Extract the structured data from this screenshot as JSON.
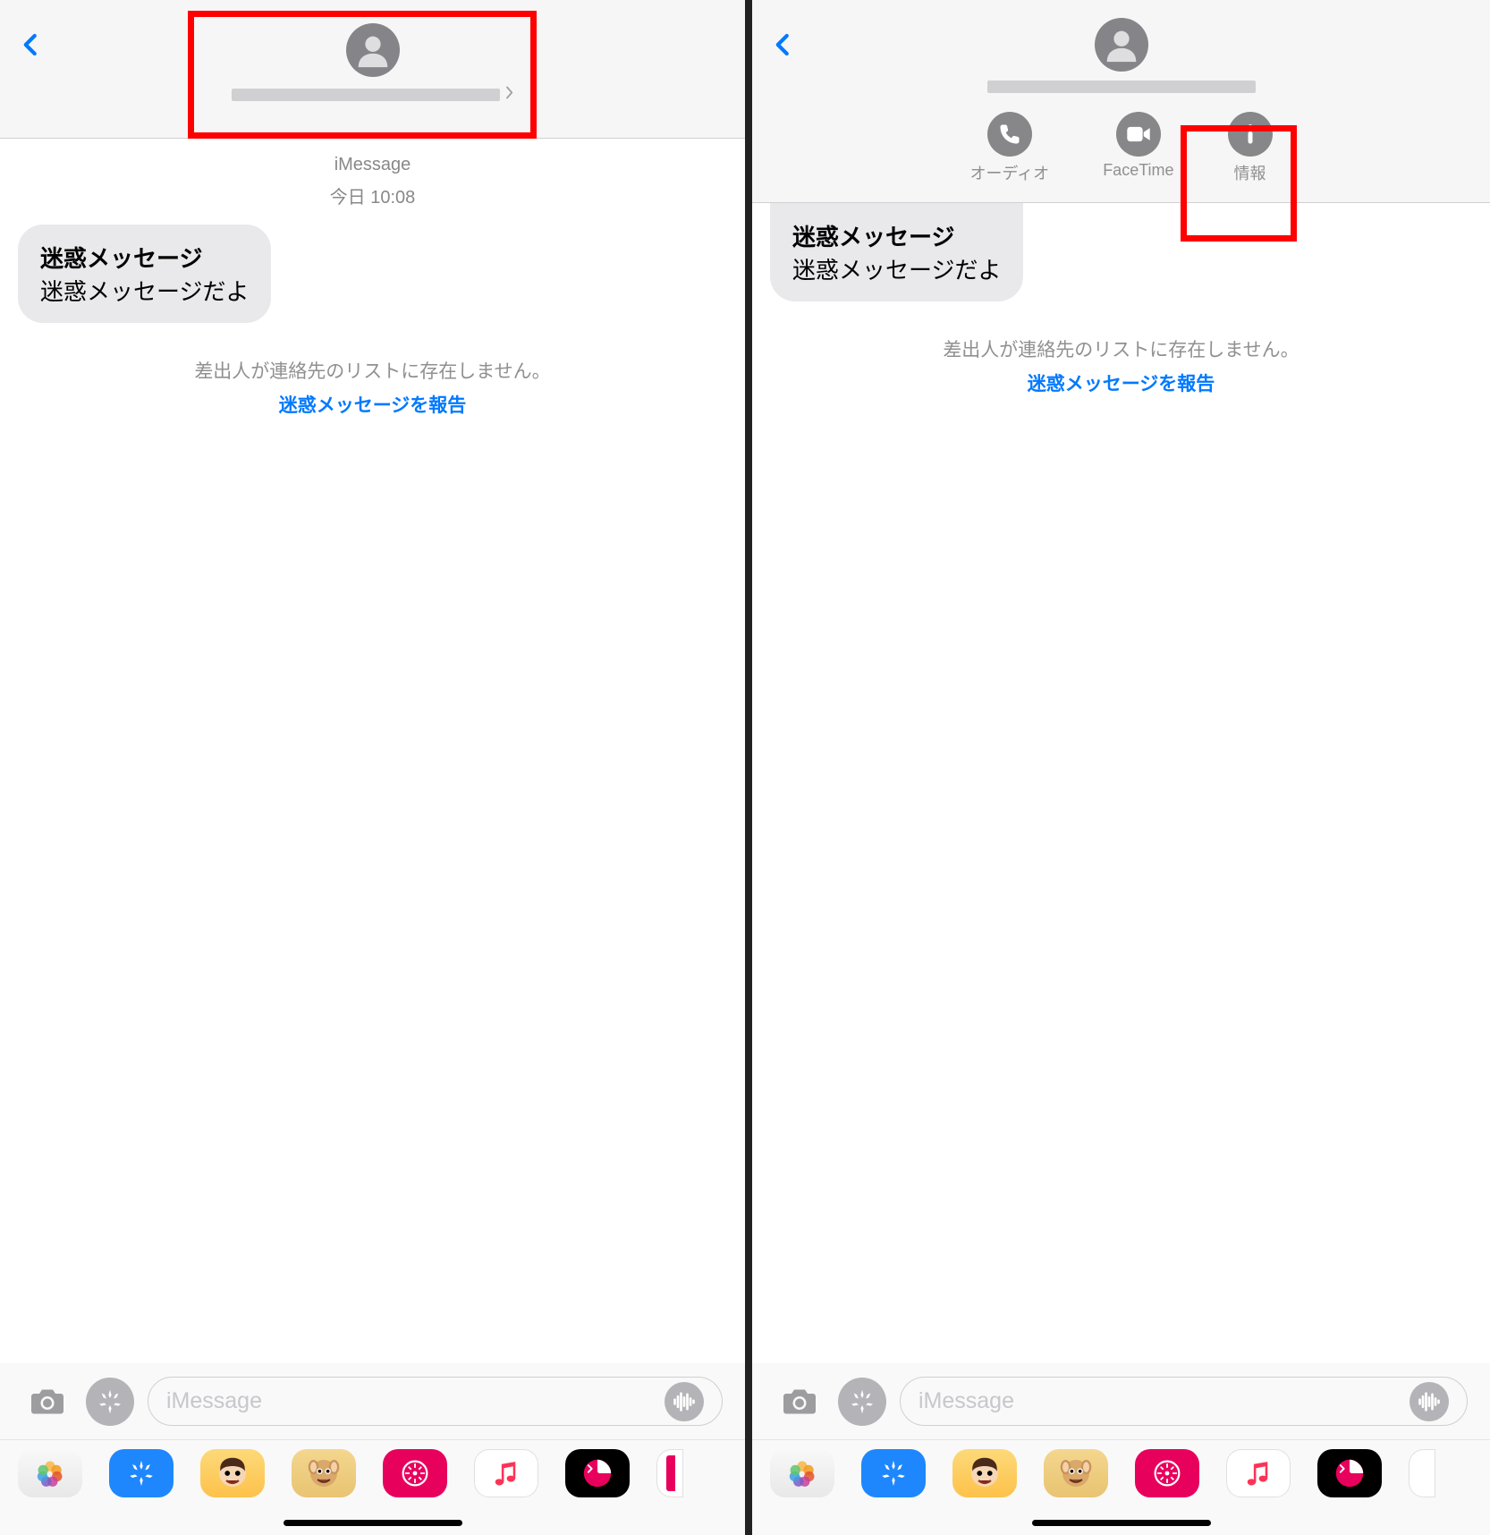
{
  "left": {
    "header": {
      "avatar": "person",
      "name_masked": true
    },
    "meta_service": "iMessage",
    "meta_date": "今日 10:08",
    "message": {
      "title": "迷惑メッセージ",
      "body": "迷惑メッセージだよ"
    },
    "notice": "差出人が連絡先のリストに存在しません。",
    "report": "迷惑メッセージを報告",
    "input_placeholder": "iMessage"
  },
  "right": {
    "header": {
      "avatar": "person",
      "name_masked": true,
      "actions": [
        {
          "icon": "phone",
          "label": "オーディオ"
        },
        {
          "icon": "video",
          "label": "FaceTime"
        },
        {
          "icon": "info",
          "label": "情報"
        }
      ]
    },
    "message": {
      "title": "迷惑メッセージ",
      "body": "迷惑メッセージだよ"
    },
    "notice": "差出人が連絡先のリストに存在しません。",
    "report": "迷惑メッセージを報告",
    "input_placeholder": "iMessage"
  },
  "app_tray": [
    "photos",
    "appstore",
    "memoji",
    "animoji",
    "digital-touch",
    "music",
    "stickers"
  ]
}
